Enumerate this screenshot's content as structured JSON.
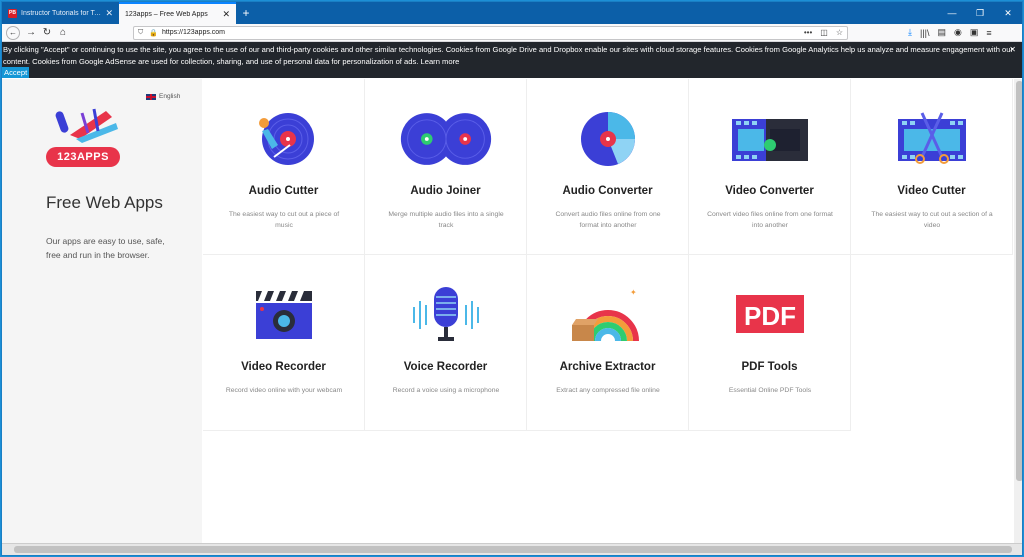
{
  "browser": {
    "tabs": [
      {
        "label": "Instructor Tutorials for Technology",
        "favicon": "PB",
        "active": false
      },
      {
        "label": "123apps – Free Web Apps",
        "active": true
      }
    ],
    "new_tab": "+",
    "url": "https://123apps.com"
  },
  "cookie": {
    "text": "By clicking \"Accept\" or continuing to use the site, you agree to the use of our and third-party cookies and other similar technologies. Cookies from Google Drive and Dropbox enable our sites with cloud storage features. Cookies from Google Analytics help us analyze and measure engagement with our content. Cookies from Google AdSense are used for collection, sharing, and use of personal data for personalization of ads.",
    "learn_more": "Learn more",
    "accept": "Accept"
  },
  "sidebar": {
    "language": "English",
    "logo_text": "123APPS",
    "title": "Free Web Apps",
    "description": "Our apps are easy to use, safe, free and run in the browser."
  },
  "apps": [
    {
      "title": "Audio Cutter",
      "desc": "The easiest way to cut out a piece of music",
      "icon": "audio-cutter-icon"
    },
    {
      "title": "Audio Joiner",
      "desc": "Merge multiple audio files into a single track",
      "icon": "audio-joiner-icon"
    },
    {
      "title": "Audio Converter",
      "desc": "Convert audio files online from one format into another",
      "icon": "audio-converter-icon"
    },
    {
      "title": "Video Converter",
      "desc": "Convert video files online from one format into another",
      "icon": "video-converter-icon"
    },
    {
      "title": "Video Cutter",
      "desc": "The easiest way to cut out a section of a video",
      "icon": "video-cutter-icon"
    },
    {
      "title": "Video Recorder",
      "desc": "Record video online with your webcam",
      "icon": "video-recorder-icon"
    },
    {
      "title": "Voice Recorder",
      "desc": "Record a voice using a microphone",
      "icon": "voice-recorder-icon"
    },
    {
      "title": "Archive Extractor",
      "desc": "Extract any compressed file online",
      "icon": "archive-extractor-icon"
    },
    {
      "title": "PDF Tools",
      "desc": "Essential Online PDF Tools",
      "icon": "pdf-tools-icon",
      "icon_text": "PDF"
    }
  ],
  "colors": {
    "brand": "#e8344a",
    "disc": "#3b3fd6",
    "accent": "#1597d6"
  }
}
